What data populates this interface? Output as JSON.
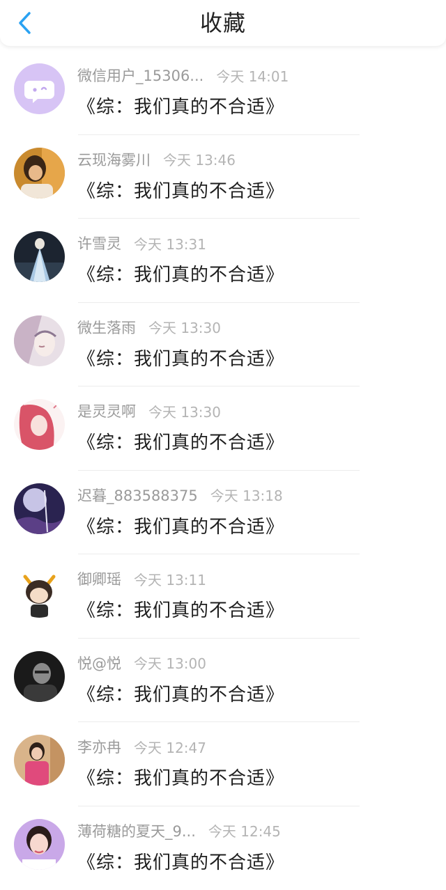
{
  "header": {
    "title": "收藏",
    "back_icon": "chevron-left-icon",
    "accent_color": "#2aa2f2"
  },
  "items": [
    {
      "username": "微信用户_15306...",
      "time": "今天 14:01",
      "message": "《综：我们真的不合适》",
      "avatar": "wechat-placeholder-avatar"
    },
    {
      "username": "云现海雾川",
      "time": "今天 13:46",
      "message": "《综：我们真的不合适》",
      "avatar": "user-avatar"
    },
    {
      "username": "许雪灵",
      "time": "今天 13:31",
      "message": "《综：我们真的不合适》",
      "avatar": "user-avatar"
    },
    {
      "username": "微生落雨",
      "time": "今天 13:30",
      "message": "《综：我们真的不合适》",
      "avatar": "user-avatar"
    },
    {
      "username": "是灵灵啊",
      "time": "今天 13:30",
      "message": "《综：我们真的不合适》",
      "avatar": "user-avatar"
    },
    {
      "username": "迟暮_883588375",
      "time": "今天 13:18",
      "message": "《综：我们真的不合适》",
      "avatar": "user-avatar"
    },
    {
      "username": "御卿瑶",
      "time": "今天 13:11",
      "message": "《综：我们真的不合适》",
      "avatar": "user-avatar"
    },
    {
      "username": "悦@悦",
      "time": "今天 13:00",
      "message": "《综：我们真的不合适》",
      "avatar": "user-avatar"
    },
    {
      "username": "李亦冉",
      "time": "今天 12:47",
      "message": "《综：我们真的不合适》",
      "avatar": "user-avatar"
    },
    {
      "username": "薄荷糖的夏天_9...",
      "time": "今天 12:45",
      "message": "《综：我们真的不合适》",
      "avatar": "user-avatar"
    }
  ]
}
